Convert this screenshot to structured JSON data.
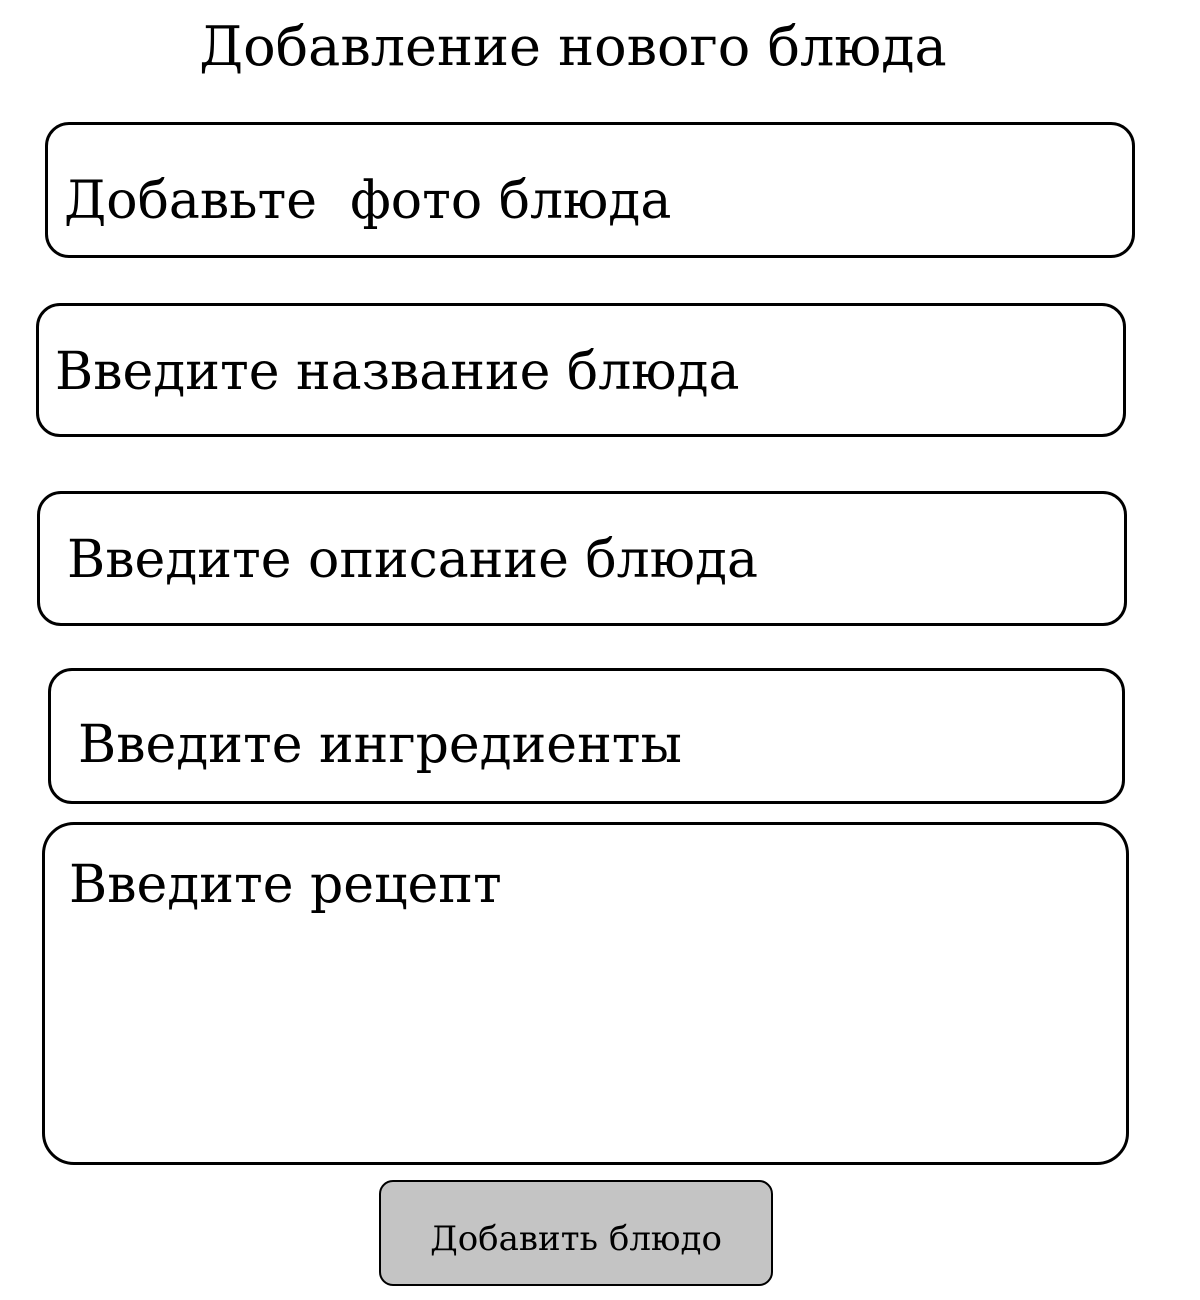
{
  "page": {
    "title": "Добавление нового блюда"
  },
  "form": {
    "photo_label": "Добавьте  фото блюда",
    "name_placeholder": "Введите название блюда",
    "description_placeholder": "Введите описание блюда",
    "ingredients_placeholder": "Введите ингредиенты",
    "recipe_placeholder": "Введите рецепт",
    "submit_label": "Добавить блюдо"
  },
  "colors": {
    "background": "#ffffff",
    "border": "#000000",
    "button_fill": "#c4c4c4"
  }
}
